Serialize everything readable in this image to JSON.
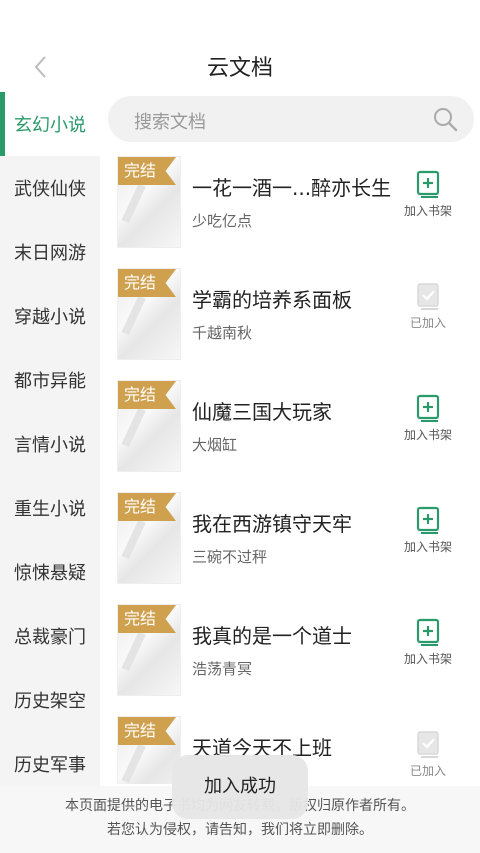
{
  "header": {
    "title": "云文档"
  },
  "sidebar": {
    "items": [
      {
        "label": "玄幻小说",
        "active": true
      },
      {
        "label": "武侠仙侠",
        "active": false
      },
      {
        "label": "末日网游",
        "active": false
      },
      {
        "label": "穿越小说",
        "active": false
      },
      {
        "label": "都市异能",
        "active": false
      },
      {
        "label": "言情小说",
        "active": false
      },
      {
        "label": "重生小说",
        "active": false
      },
      {
        "label": "惊悚悬疑",
        "active": false
      },
      {
        "label": "总裁豪门",
        "active": false
      },
      {
        "label": "历史架空",
        "active": false
      },
      {
        "label": "历史军事",
        "active": false
      }
    ]
  },
  "search": {
    "placeholder": "搜索文档"
  },
  "books": [
    {
      "badge": "完结",
      "title": "一花一酒一...醉亦长生",
      "author": "少吃亿点",
      "action": "加入书架",
      "added": false
    },
    {
      "badge": "完结",
      "title": "学霸的培养系面板",
      "author": "千越南秋",
      "action": "已加入",
      "added": true
    },
    {
      "badge": "完结",
      "title": "仙魔三国大玩家",
      "author": "大烟缸",
      "action": "加入书架",
      "added": false
    },
    {
      "badge": "完结",
      "title": "我在西游镇守天牢",
      "author": "三碗不过秤",
      "action": "加入书架",
      "added": false
    },
    {
      "badge": "完结",
      "title": "我真的是一个道士",
      "author": "浩荡青冥",
      "action": "加入书架",
      "added": false
    },
    {
      "badge": "完结",
      "title": "天道今天不上班",
      "author": "",
      "action": "已加入",
      "added": true
    }
  ],
  "footer": {
    "line1": "本页面提供的电子书均为网友转载，版权归原作者所有。",
    "line2": "若您认为侵权，请告知，我们将立即删除。"
  },
  "toast": {
    "text": "加入成功"
  },
  "colors": {
    "accent": "#2b9a6a",
    "badge": "#cfa14e"
  }
}
